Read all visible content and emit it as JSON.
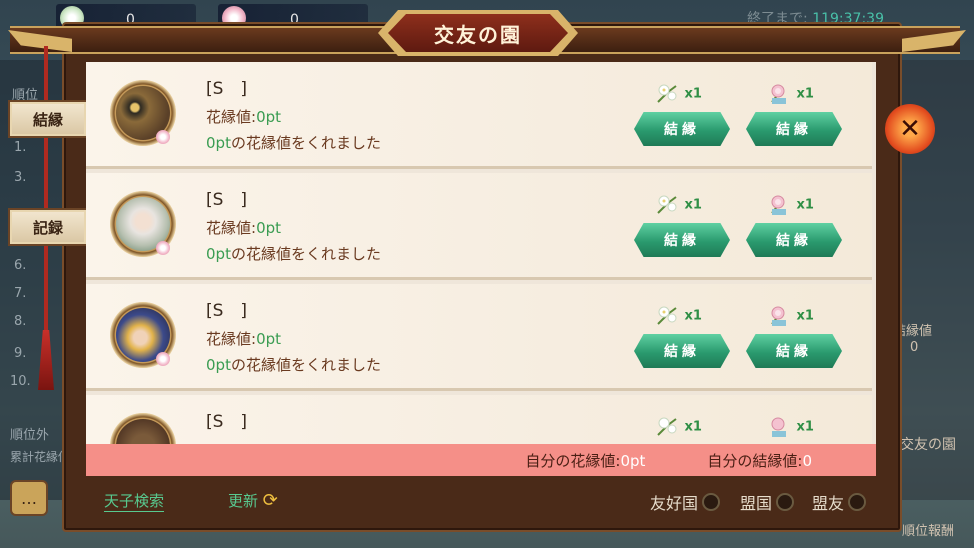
{
  "background": {
    "counters": [
      {
        "value": "0"
      },
      {
        "value": "0"
      }
    ],
    "timer_label": "終了まで:",
    "timer_value": "119:37:39",
    "left_texts": [
      "順位",
      "1.",
      "3.",
      "6.",
      "7.",
      "8.",
      "9.",
      "10.",
      "順位外",
      "累計花縁値"
    ],
    "right_texts": [
      "結縁値",
      "0",
      "交友の園",
      "順位報酬"
    ]
  },
  "dialog": {
    "title": "交友の園",
    "tabs": [
      {
        "label": "結縁"
      },
      {
        "label": "記録"
      }
    ],
    "close_icon": "close-icon",
    "rows": [
      {
        "name": "[S　]",
        "value_label": "花縁値:",
        "value": "0pt",
        "given_amount": "0pt",
        "given_text": "の花縁値をくれました",
        "gift1_count": "x1",
        "gift2_count": "x1",
        "btn1": "結縁",
        "btn2": "結縁",
        "avatar": "owl"
      },
      {
        "name": "[S　]",
        "value_label": "花縁値:",
        "value": "0pt",
        "given_amount": "0pt",
        "given_text": "の花縁値をくれました",
        "gift1_count": "x1",
        "gift2_count": "x1",
        "btn1": "結縁",
        "btn2": "結縁",
        "avatar": "white-hair-lady"
      },
      {
        "name": "[S　]",
        "value_label": "花縁値:",
        "value": "0pt",
        "given_amount": "0pt",
        "given_text": "の花縁値をくれました",
        "gift1_count": "x1",
        "gift2_count": "x1",
        "btn1": "結縁",
        "btn2": "結縁",
        "avatar": "blonde-lady"
      },
      {
        "name": "[S　]",
        "gift1_count": "x1",
        "gift2_count": "x1",
        "avatar": "partial"
      }
    ],
    "summary": {
      "my_flower_label": "自分の花縁値:",
      "my_flower_value": "0pt",
      "my_bond_label": "自分の結縁値:",
      "my_bond_value": "0"
    },
    "bottom": {
      "search_label": "天子検索",
      "refresh_label": "更新",
      "filters": [
        {
          "label": "友好国"
        },
        {
          "label": "盟国"
        },
        {
          "label": "盟友"
        }
      ]
    }
  },
  "colors": {
    "accent_green": "#3a9c52",
    "summary_bar": "#f58f88",
    "button_green": "#2a9a6e",
    "frame_brown": "#4a2a18"
  }
}
